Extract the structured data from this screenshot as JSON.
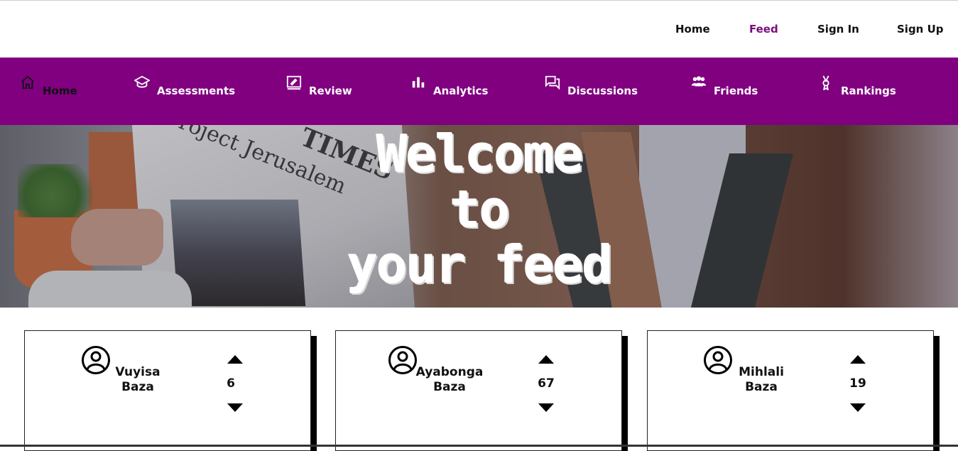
{
  "topnav": {
    "items": [
      {
        "label": "Home",
        "active": false
      },
      {
        "label": "Feed",
        "active": true
      },
      {
        "label": "Sign In",
        "active": false
      },
      {
        "label": "Sign Up",
        "active": false
      }
    ],
    "active_color": "#7a0d7c"
  },
  "mainbar": {
    "color": "#800080",
    "items": [
      {
        "label": "Home",
        "icon": "home-icon"
      },
      {
        "label": "Assessments",
        "icon": "graduation-cap-icon"
      },
      {
        "label": "Review",
        "icon": "edit-note-icon"
      },
      {
        "label": "Analytics",
        "icon": "bar-chart-icon"
      },
      {
        "label": "Discussions",
        "icon": "chat-bubbles-icon"
      },
      {
        "label": "Friends",
        "icon": "group-icon"
      },
      {
        "label": "Rankings",
        "icon": "award-icon"
      }
    ]
  },
  "hero": {
    "title_line1": "Welcome",
    "title_line2": "to",
    "title_line3": "your feed",
    "image_text_1": "Project Jerusalem",
    "image_text_2": "TIMES"
  },
  "cards": [
    {
      "first": "Vuyisa",
      "last": "Baza",
      "score": "6"
    },
    {
      "first": "Ayabonga",
      "last": "Baza",
      "score": "67"
    },
    {
      "first": "Mihlali",
      "last": "Baza",
      "score": "19"
    }
  ]
}
